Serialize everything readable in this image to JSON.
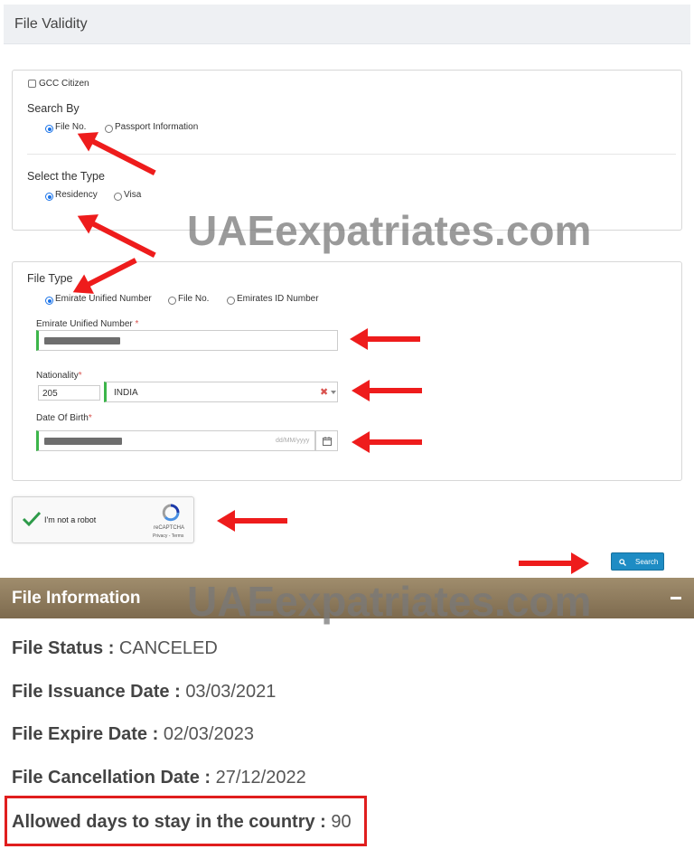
{
  "header": {
    "title": "File Validity"
  },
  "search_panel": {
    "gcc_citizen_label": "GCC Citizen",
    "search_by": {
      "label": "Search By",
      "options": [
        "File No.",
        "Passport Information"
      ],
      "selected": "File No."
    },
    "select_type": {
      "label": "Select the Type",
      "options": [
        "Residency",
        "Visa"
      ],
      "selected": "Residency"
    }
  },
  "file_panel": {
    "file_type": {
      "label": "File Type",
      "options": [
        "Emirate Unified Number",
        "File No.",
        "Emirates ID Number"
      ],
      "selected": "Emirate Unified Number"
    },
    "unified_number": {
      "label": "Emirate Unified Number"
    },
    "nationality": {
      "label": "Nationality",
      "code": "205",
      "value": "INDIA"
    },
    "dob": {
      "label": "Date Of Birth",
      "placeholder": "dd/MM/yyyy"
    }
  },
  "captcha": {
    "label": "I'm not a robot",
    "brand": "reCAPTCHA",
    "links": "Privacy - Terms"
  },
  "search_button": {
    "label": "Search"
  },
  "file_info": {
    "title": "File Information",
    "status_label": "File Status :",
    "status_value": "CANCELED",
    "issuance_label": "File Issuance Date :",
    "issuance_value": "03/03/2021",
    "expire_label": "File Expire Date :",
    "expire_value": "02/03/2023",
    "cancel_label": "File Cancellation Date :",
    "cancel_value": "27/12/2022",
    "allowed_label": "Allowed days to stay in the country :",
    "allowed_value": "90"
  },
  "watermark": "UAEexpatriates.com",
  "colors": {
    "accent": "#1e8cc4",
    "valid_field": "#3cb54a",
    "annotation": "#ee1c1c",
    "info_bar": "#8d7a5d"
  }
}
